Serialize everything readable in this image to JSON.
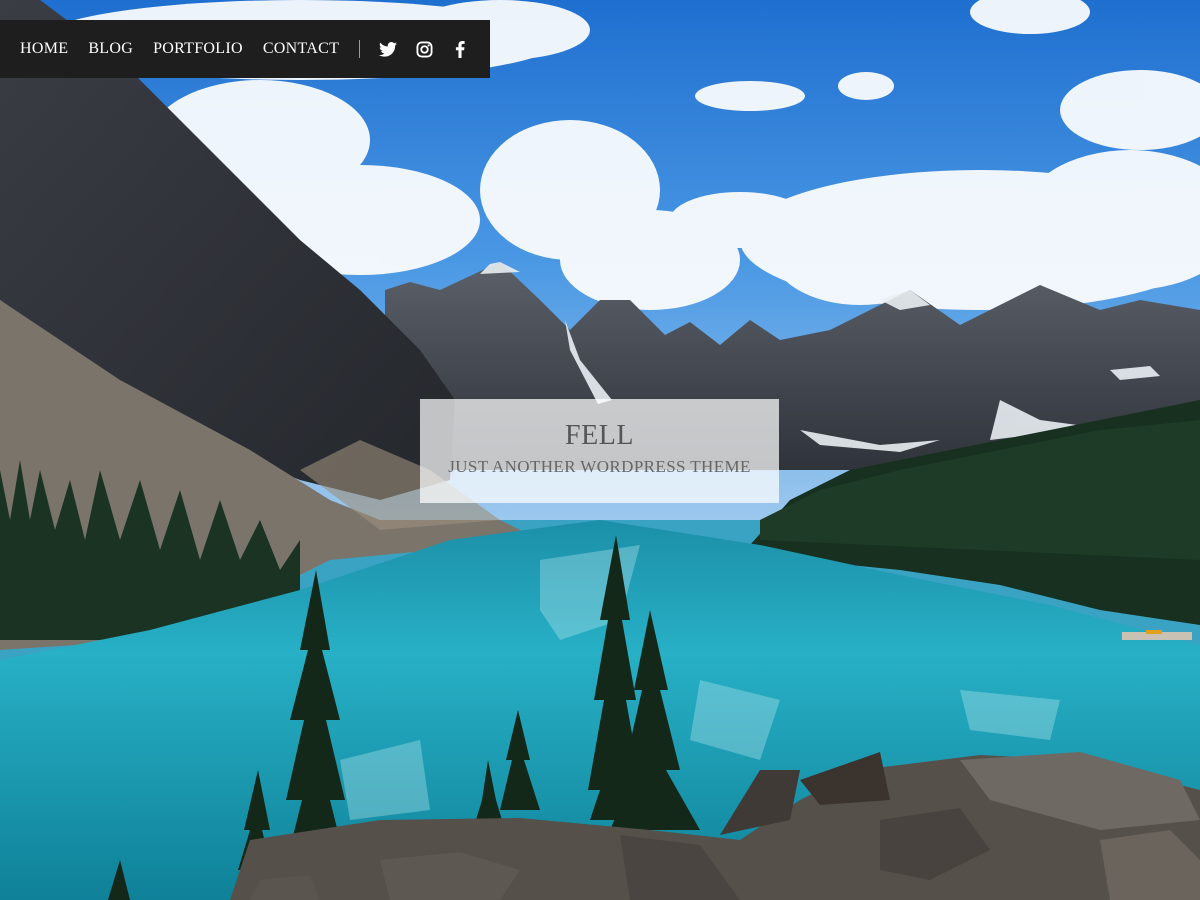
{
  "nav": {
    "items": [
      {
        "label": "HOME"
      },
      {
        "label": "BLOG"
      },
      {
        "label": "PORTFOLIO"
      },
      {
        "label": "CONTACT"
      }
    ],
    "social": [
      {
        "icon": "twitter-icon"
      },
      {
        "icon": "instagram-icon"
      },
      {
        "icon": "facebook-icon"
      }
    ]
  },
  "site": {
    "title": "FELL",
    "tagline": "JUST ANOTHER WORDPRESS THEME"
  },
  "colors": {
    "nav_bg": "#1e1e1e",
    "sky": "#2f7fd6",
    "lake": "#1aa4b8",
    "forest": "#1f3b2a"
  }
}
